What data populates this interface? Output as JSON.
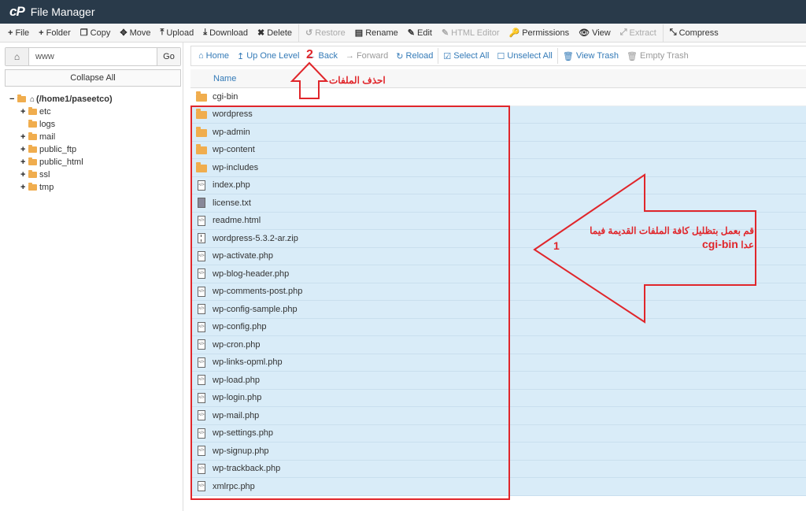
{
  "app": {
    "logo": "cP",
    "title": "File Manager"
  },
  "toolbar": [
    {
      "icon": "+",
      "label": "File",
      "name": "new-file-button",
      "disabled": false
    },
    {
      "icon": "+",
      "label": "Folder",
      "name": "new-folder-button",
      "disabled": false
    },
    {
      "icon": "❐",
      "label": "Copy",
      "name": "copy-button",
      "disabled": false
    },
    {
      "icon": "✥",
      "label": "Move",
      "name": "move-button",
      "disabled": false
    },
    {
      "icon": "⤒",
      "label": "Upload",
      "name": "upload-button",
      "disabled": false
    },
    {
      "icon": "⤓",
      "label": "Download",
      "name": "download-button",
      "disabled": false
    },
    {
      "icon": "✖",
      "label": "Delete",
      "name": "delete-button",
      "disabled": false
    },
    {
      "icon": "↺",
      "label": "Restore",
      "name": "restore-button",
      "disabled": true
    },
    {
      "icon": "▤",
      "label": "Rename",
      "name": "rename-button",
      "disabled": false
    },
    {
      "icon": "✎",
      "label": "Edit",
      "name": "edit-button",
      "disabled": false
    },
    {
      "icon": "✎",
      "label": "HTML Editor",
      "name": "html-editor-button",
      "disabled": true
    },
    {
      "icon": "🔑",
      "label": "Permissions",
      "name": "permissions-button",
      "disabled": false
    },
    {
      "icon": "👁",
      "label": "View",
      "name": "view-button",
      "disabled": false
    },
    {
      "icon": "⤢",
      "label": "Extract",
      "name": "extract-button",
      "disabled": true
    },
    {
      "icon": "⤡",
      "label": "Compress",
      "name": "compress-button",
      "disabled": false
    }
  ],
  "dirbar": {
    "value": "www",
    "go": "Go"
  },
  "collapse_label": "Collapse All",
  "tree": {
    "root": "(/home1/paseetco)",
    "children": [
      {
        "label": "etc",
        "expandable": true
      },
      {
        "label": "logs",
        "expandable": false
      },
      {
        "label": "mail",
        "expandable": true
      },
      {
        "label": "public_ftp",
        "expandable": true
      },
      {
        "label": "public_html",
        "expandable": true
      },
      {
        "label": "ssl",
        "expandable": true
      },
      {
        "label": "tmp",
        "expandable": true
      }
    ]
  },
  "navbar": [
    {
      "icon": "⌂",
      "label": "Home",
      "name": "home-button",
      "disabled": false
    },
    {
      "icon": "↥",
      "label": "Up One Level",
      "name": "up-one-level-button",
      "disabled": false
    },
    {
      "icon": "←",
      "label": "Back",
      "name": "back-button",
      "disabled": false
    },
    {
      "icon": "→",
      "label": "Forward",
      "name": "forward-button",
      "disabled": true
    },
    {
      "icon": "↻",
      "label": "Reload",
      "name": "reload-button",
      "disabled": false
    },
    {
      "icon": "☑",
      "label": "Select All",
      "name": "select-all-button",
      "disabled": false
    },
    {
      "icon": "☐",
      "label": "Unselect All",
      "name": "unselect-all-button",
      "disabled": false
    },
    {
      "icon": "🗑",
      "label": "View Trash",
      "name": "view-trash-button",
      "disabled": false
    },
    {
      "icon": "🗑",
      "label": "Empty Trash",
      "name": "empty-trash-button",
      "disabled": true
    }
  ],
  "list_header": {
    "name": "Name"
  },
  "files": [
    {
      "name": "cgi-bin",
      "type": "folder",
      "selected": false
    },
    {
      "name": "wordpress",
      "type": "folder",
      "selected": true
    },
    {
      "name": "wp-admin",
      "type": "folder",
      "selected": true
    },
    {
      "name": "wp-content",
      "type": "folder",
      "selected": true
    },
    {
      "name": "wp-includes",
      "type": "folder",
      "selected": true
    },
    {
      "name": "index.php",
      "type": "code",
      "selected": true
    },
    {
      "name": "license.txt",
      "type": "text",
      "selected": true
    },
    {
      "name": "readme.html",
      "type": "code",
      "selected": true
    },
    {
      "name": "wordpress-5.3.2-ar.zip",
      "type": "zip",
      "selected": true
    },
    {
      "name": "wp-activate.php",
      "type": "code",
      "selected": true
    },
    {
      "name": "wp-blog-header.php",
      "type": "code",
      "selected": true
    },
    {
      "name": "wp-comments-post.php",
      "type": "code",
      "selected": true
    },
    {
      "name": "wp-config-sample.php",
      "type": "code",
      "selected": true
    },
    {
      "name": "wp-config.php",
      "type": "code",
      "selected": true
    },
    {
      "name": "wp-cron.php",
      "type": "code",
      "selected": true
    },
    {
      "name": "wp-links-opml.php",
      "type": "code",
      "selected": true
    },
    {
      "name": "wp-load.php",
      "type": "code",
      "selected": true
    },
    {
      "name": "wp-login.php",
      "type": "code",
      "selected": true
    },
    {
      "name": "wp-mail.php",
      "type": "code",
      "selected": true
    },
    {
      "name": "wp-settings.php",
      "type": "code",
      "selected": true
    },
    {
      "name": "wp-signup.php",
      "type": "code",
      "selected": true
    },
    {
      "name": "wp-trackback.php",
      "type": "code",
      "selected": true
    },
    {
      "name": "xmlrpc.php",
      "type": "code",
      "selected": true
    }
  ],
  "annotations": {
    "step2_number": "2",
    "step2_note": "احذف الملفات",
    "step1_number": "1",
    "step1_note_line1": "قم بعمل بتظليل كافة الملفات القديمة فيما",
    "step1_note_line2a": "عدا",
    "step1_note_line2b": "cgi-bin",
    "color": "#e0262b"
  }
}
